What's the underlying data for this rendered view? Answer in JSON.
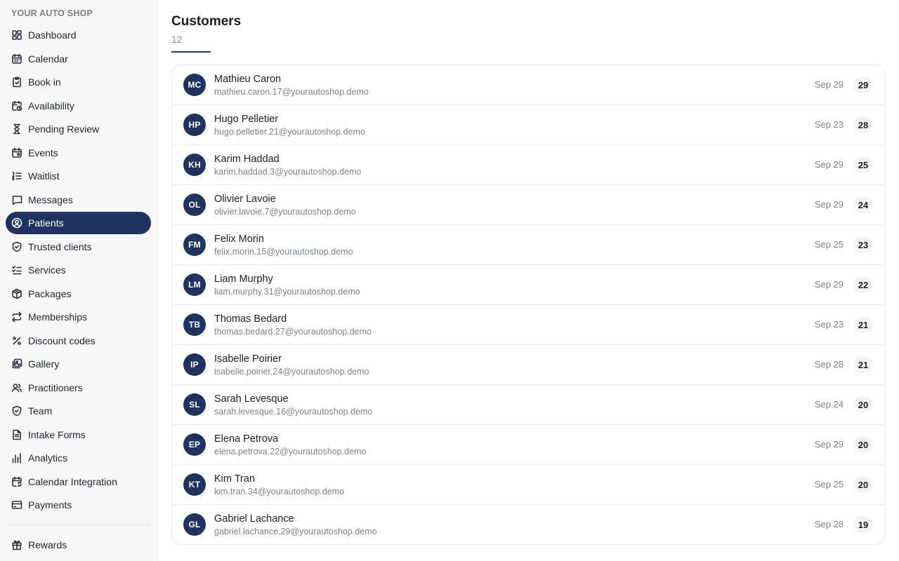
{
  "sidebar": {
    "brand": "YOUR AUTO SHOP",
    "items": [
      {
        "label": "Dashboard",
        "icon": "dashboard-icon",
        "active": false
      },
      {
        "label": "Calendar",
        "icon": "calendar-icon",
        "active": false
      },
      {
        "label": "Book in",
        "icon": "clipboard-icon",
        "active": false
      },
      {
        "label": "Availability",
        "icon": "calendar-clock-icon",
        "active": false
      },
      {
        "label": "Pending Review",
        "icon": "hourglass-icon",
        "active": false
      },
      {
        "label": "Events",
        "icon": "calendar-event-icon",
        "active": false
      },
      {
        "label": "Waitlist",
        "icon": "list-ordered-icon",
        "active": false
      },
      {
        "label": "Messages",
        "icon": "message-icon",
        "active": false
      },
      {
        "label": "Patients",
        "icon": "user-circle-icon",
        "active": true
      },
      {
        "label": "Trusted clients",
        "icon": "shield-check-icon",
        "active": false
      },
      {
        "label": "Services",
        "icon": "list-checks-icon",
        "active": false
      },
      {
        "label": "Packages",
        "icon": "package-icon",
        "active": false
      },
      {
        "label": "Memberships",
        "icon": "repeat-icon",
        "active": false
      },
      {
        "label": "Discount codes",
        "icon": "percent-icon",
        "active": false
      },
      {
        "label": "Gallery",
        "icon": "gallery-icon",
        "active": false
      },
      {
        "label": "Practitioners",
        "icon": "users-icon",
        "active": false
      },
      {
        "label": "Team",
        "icon": "shield-icon",
        "active": false
      },
      {
        "label": "Intake Forms",
        "icon": "document-icon",
        "active": false
      },
      {
        "label": "Analytics",
        "icon": "bar-chart-icon",
        "active": false
      },
      {
        "label": "Calendar Integration",
        "icon": "calendar-sync-icon",
        "active": false
      },
      {
        "label": "Payments",
        "icon": "credit-card-icon",
        "active": false
      }
    ],
    "footer_items": [
      {
        "label": "Rewards",
        "icon": "gift-icon"
      }
    ]
  },
  "main": {
    "title": "Customers",
    "count": "12",
    "customers": [
      {
        "initials": "MC",
        "name": "Mathieu Caron",
        "email": "mathieu.caron.17@yourautoshop.demo",
        "date": "Sep 29",
        "visits": "29"
      },
      {
        "initials": "HP",
        "name": "Hugo Pelletier",
        "email": "hugo.pelletier.21@yourautoshop.demo",
        "date": "Sep 23",
        "visits": "28"
      },
      {
        "initials": "KH",
        "name": "Karim Haddad",
        "email": "karim.haddad.3@yourautoshop.demo",
        "date": "Sep 29",
        "visits": "25"
      },
      {
        "initials": "OL",
        "name": "Olivier Lavoie",
        "email": "olivier.lavoie.7@yourautoshop.demo",
        "date": "Sep 29",
        "visits": "24"
      },
      {
        "initials": "FM",
        "name": "Felix Morin",
        "email": "felix.morin.15@yourautoshop.demo",
        "date": "Sep 25",
        "visits": "23"
      },
      {
        "initials": "LM",
        "name": "Liam Murphy",
        "email": "liam.murphy.31@yourautoshop.demo",
        "date": "Sep 29",
        "visits": "22"
      },
      {
        "initials": "TB",
        "name": "Thomas Bedard",
        "email": "thomas.bedard.27@yourautoshop.demo",
        "date": "Sep 23",
        "visits": "21"
      },
      {
        "initials": "IP",
        "name": "Isabelle Poirier",
        "email": "isabelle.poirier.24@yourautoshop.demo",
        "date": "Sep 28",
        "visits": "21"
      },
      {
        "initials": "SL",
        "name": "Sarah Levesque",
        "email": "sarah.levesque.16@yourautoshop.demo",
        "date": "Sep 24",
        "visits": "20"
      },
      {
        "initials": "EP",
        "name": "Elena Petrova",
        "email": "elena.petrova.22@yourautoshop.demo",
        "date": "Sep 29",
        "visits": "20"
      },
      {
        "initials": "KT",
        "name": "Kim Tran",
        "email": "kim.tran.34@yourautoshop.demo",
        "date": "Sep 25",
        "visits": "20"
      },
      {
        "initials": "GL",
        "name": "Gabriel Lachance",
        "email": "gabriel.lachance.29@yourautoshop.demo",
        "date": "Sep 28",
        "visits": "19"
      }
    ]
  },
  "colors": {
    "accent": "#1d3461",
    "sidebar_bg": "#f7f7f8",
    "muted_text": "#7d828c"
  }
}
